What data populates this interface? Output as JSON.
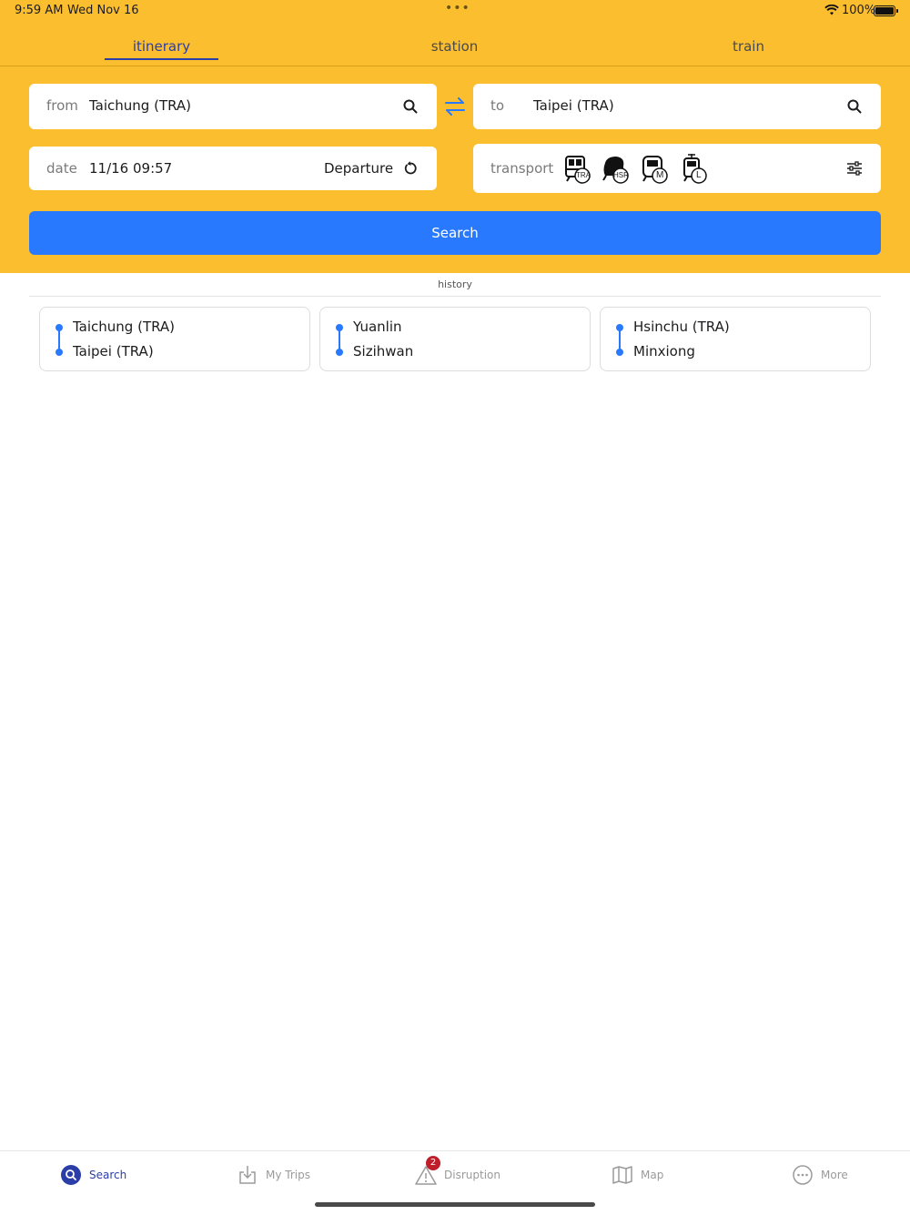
{
  "status_bar": {
    "time": "9:59 AM",
    "date": "Wed Nov 16",
    "battery": "100%"
  },
  "tabs": [
    {
      "label": "itinerary",
      "active": true
    },
    {
      "label": "station",
      "active": false
    },
    {
      "label": "train",
      "active": false
    }
  ],
  "form": {
    "from_label": "from",
    "from_value": "Taichung (TRA)",
    "to_label": "to",
    "to_value": "Taipei (TRA)",
    "date_label": "date",
    "date_value": "11/16 09:57",
    "departure_label": "Departure",
    "transport_label": "transport",
    "transport_modes": [
      "TRA",
      "HSR",
      "M",
      "L"
    ],
    "search_button": "Search"
  },
  "history": {
    "label": "history",
    "items": [
      {
        "from": "Taichung (TRA)",
        "to": "Taipei (TRA)"
      },
      {
        "from": "Yuanlin",
        "to": "Sizihwan"
      },
      {
        "from": "Hsinchu (TRA)",
        "to": "Minxiong"
      }
    ]
  },
  "bottom_nav": [
    {
      "label": "Search",
      "icon": "search-icon",
      "active": true
    },
    {
      "label": "My Trips",
      "icon": "download-icon",
      "active": false
    },
    {
      "label": "Disruption",
      "icon": "warning-icon",
      "active": false,
      "badge": "2"
    },
    {
      "label": "Map",
      "icon": "map-icon",
      "active": false
    },
    {
      "label": "More",
      "icon": "more-icon",
      "active": false
    }
  ],
  "colors": {
    "header": "#fbbe2f",
    "accent": "#2979ff",
    "active_tab": "#2b3ea8",
    "badge": "#c01d2b"
  }
}
